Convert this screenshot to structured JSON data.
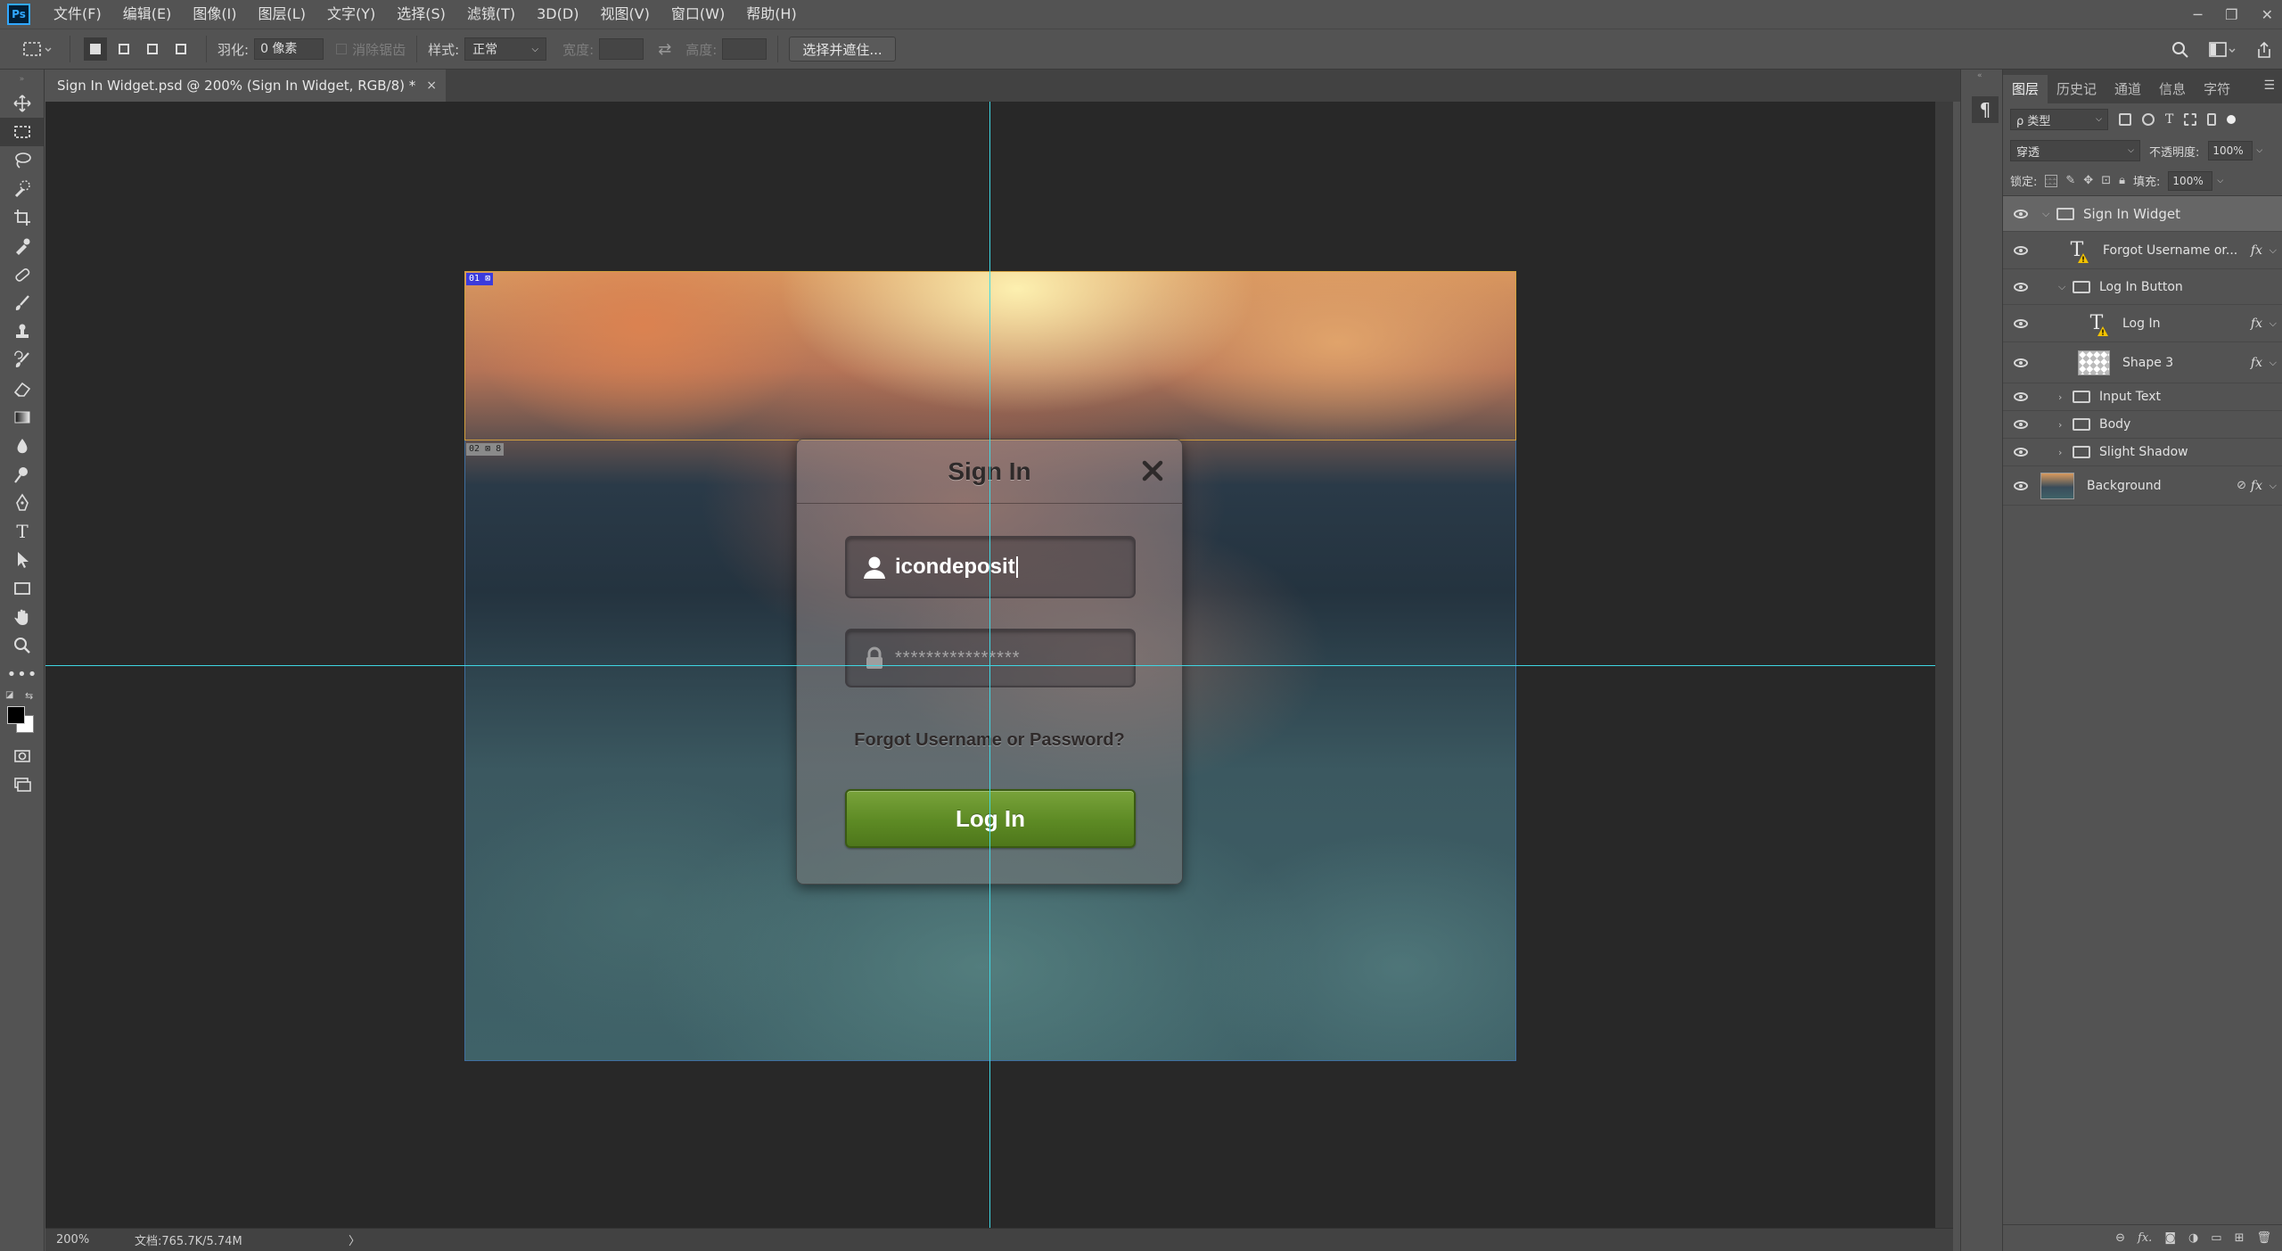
{
  "app": {
    "logo": "Ps"
  },
  "menu": [
    "文件(F)",
    "编辑(E)",
    "图像(I)",
    "图层(L)",
    "文字(Y)",
    "选择(S)",
    "滤镜(T)",
    "3D(D)",
    "视图(V)",
    "窗口(W)",
    "帮助(H)"
  ],
  "options": {
    "feather_label": "羽化:",
    "feather_value": "0 像素",
    "antialias_label": "消除锯齿",
    "style_label": "样式:",
    "style_value": "正常",
    "width_label": "宽度:",
    "height_label": "高度:",
    "select_mask_button": "选择并遮住..."
  },
  "document": {
    "tab_title": "Sign In Widget.psd @ 200% (Sign In Widget, RGB/8) *",
    "tab_close": "×"
  },
  "slices": {
    "top_label": "01",
    "rest_label": "02",
    "rest_extra": "8"
  },
  "widget": {
    "title": "Sign In",
    "username_value": "icondeposit",
    "password_value": "****************",
    "forgot_text": "Forgot Username or Password?",
    "login_button": "Log In"
  },
  "status": {
    "zoom": "200%",
    "doc_info": "文档:765.7K/5.74M",
    "arrow": "〉"
  },
  "panel": {
    "tabs": [
      "图层",
      "历史记",
      "通道",
      "信息",
      "字符"
    ],
    "filter_label": "ρ 类型",
    "blend_mode": "穿透",
    "opacity_label": "不透明度:",
    "opacity_value": "100%",
    "lock_label": "锁定:",
    "fill_label": "填充:",
    "fill_value": "100%",
    "layers": [
      {
        "name": "Sign In Widget",
        "kind": "group",
        "level": 0,
        "open": true,
        "selected": true,
        "fx": ""
      },
      {
        "name": "Forgot Username or...",
        "kind": "text-warn",
        "level": 1,
        "fx": "fx"
      },
      {
        "name": "Log In Button",
        "kind": "group",
        "level": 1,
        "open": true,
        "fx": ""
      },
      {
        "name": "Log In",
        "kind": "text-warn",
        "level": 2,
        "fx": "fx"
      },
      {
        "name": "Shape 3",
        "kind": "shape",
        "level": 2,
        "fx": "fx"
      },
      {
        "name": "Input Text",
        "kind": "group",
        "level": 1,
        "open": false,
        "fx": ""
      },
      {
        "name": "Body",
        "kind": "group",
        "level": 1,
        "open": false,
        "fx": ""
      },
      {
        "name": "Slight Shadow",
        "kind": "group",
        "level": 1,
        "open": false,
        "fx": ""
      },
      {
        "name": "Background",
        "kind": "image",
        "level": 0,
        "fx": "fx"
      }
    ]
  },
  "colors": {
    "guide": "#3fd7e3",
    "login_green": "#5d8a24",
    "panel_bg": "#535353",
    "canvas_bg": "#282828"
  }
}
